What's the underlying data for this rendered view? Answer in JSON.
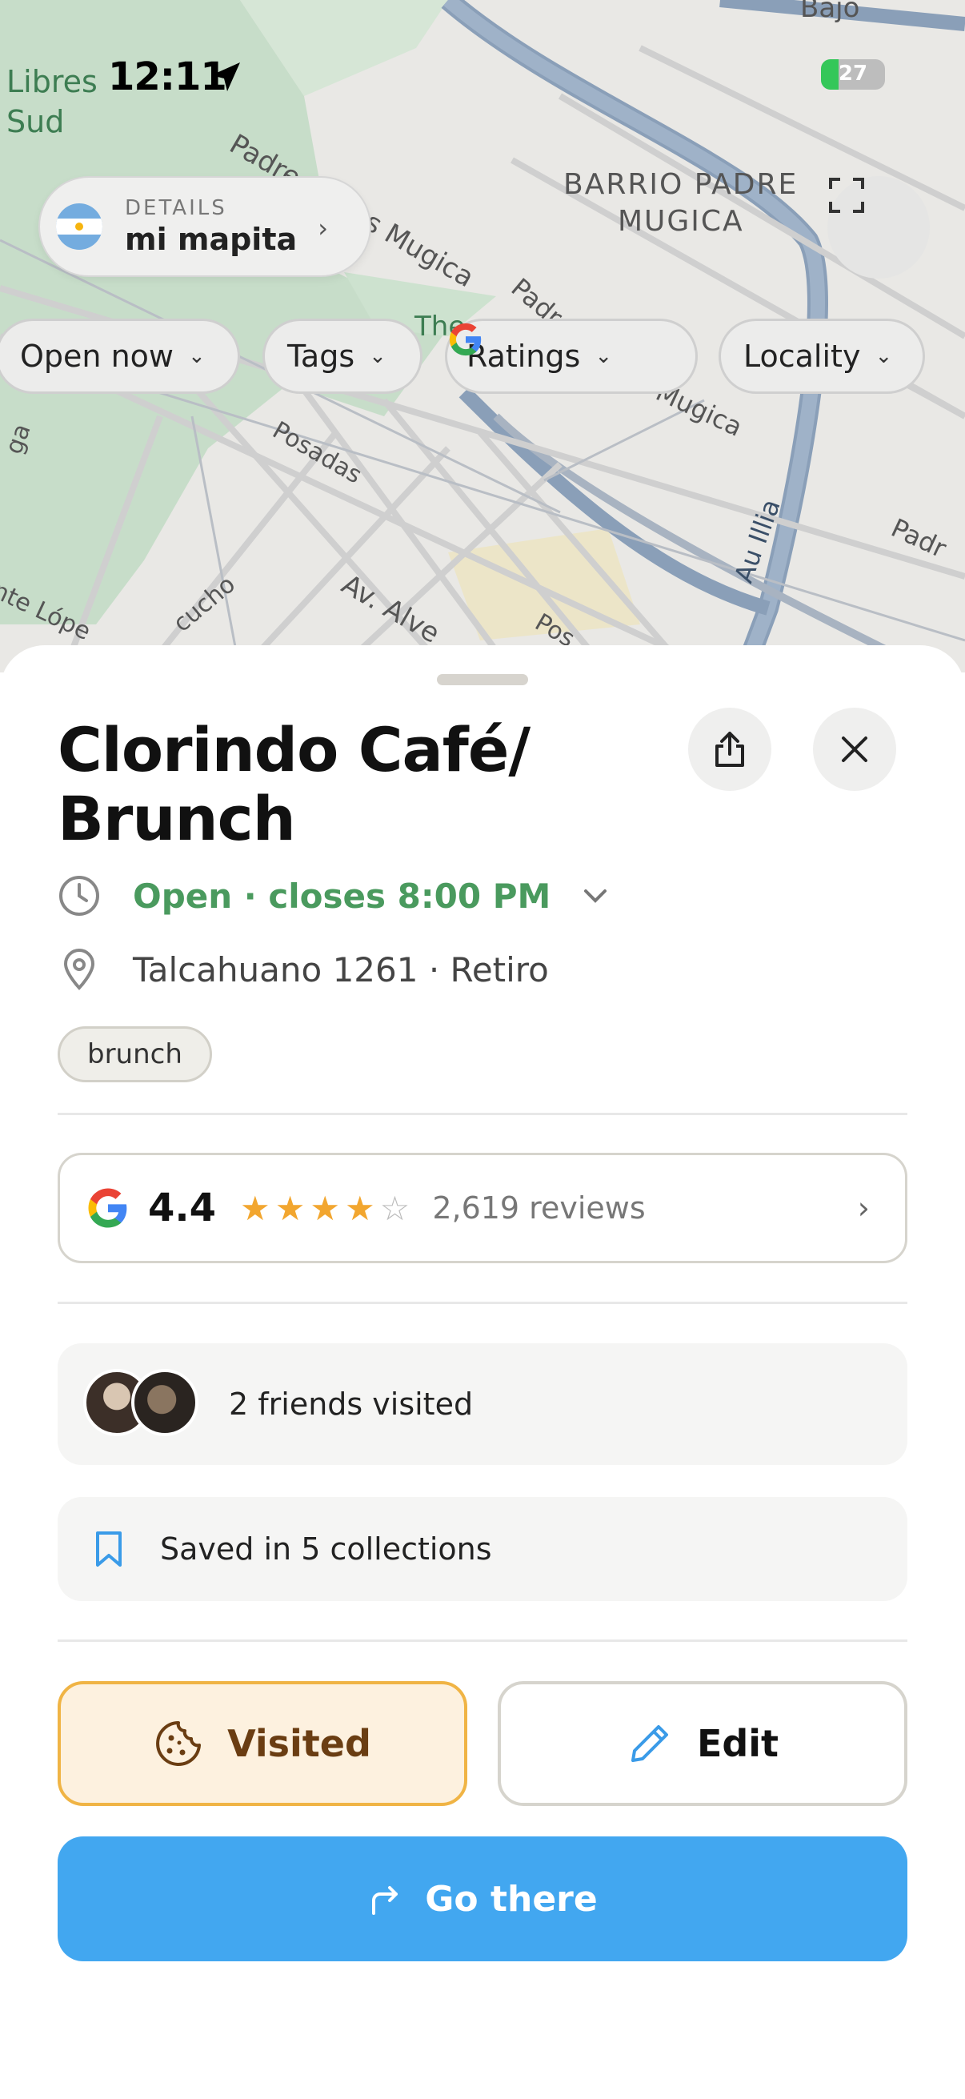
{
  "status_bar": {
    "time": "12:11",
    "battery": "27"
  },
  "map": {
    "labels": {
      "libres": "Libres",
      "sud": "Sud",
      "street_padre_carlos": "Padre Carlos Mugica",
      "barrio_line1": "BARRIO PADRE",
      "barrio_line2": "MUGICA",
      "padre": "Padre",
      "mugica": "Mugica",
      "posadas": "Posadas",
      "av_alvear": "Av. Alve",
      "illia": "Au Illia",
      "padre_right": "Padr",
      "lope": "nte Lópe",
      "cucho": "cucho",
      "pos": "Pos",
      "ga": "ga",
      "the": "The",
      "bajo": "Bajo"
    }
  },
  "collection_pill": {
    "subtitle": "DETAILS",
    "title": "mi mapita"
  },
  "filters": [
    {
      "label": "Open now"
    },
    {
      "label": "Tags"
    },
    {
      "label": "Ratings"
    },
    {
      "label": "Locality"
    }
  ],
  "place": {
    "name_line1": "Clorindo Café/",
    "name_line2": "Brunch",
    "hours": "Open · closes 8:00 PM",
    "address": "Talcahuano 1261 · Retiro",
    "tag": "brunch"
  },
  "rating": {
    "value": "4.4",
    "stars": 4.4,
    "reviews": "2,619 reviews"
  },
  "friends": {
    "text": "2 friends visited"
  },
  "collections": {
    "text": "Saved in 5 collections"
  },
  "actions": {
    "visited": "Visited",
    "edit": "Edit",
    "go": "Go there"
  },
  "colors": {
    "open_green": "#4a9a5e",
    "accent_blue": "#42a7f0",
    "visited_bg": "#fdf1df",
    "visited_border": "#f0b445",
    "star": "#f2a62f"
  }
}
